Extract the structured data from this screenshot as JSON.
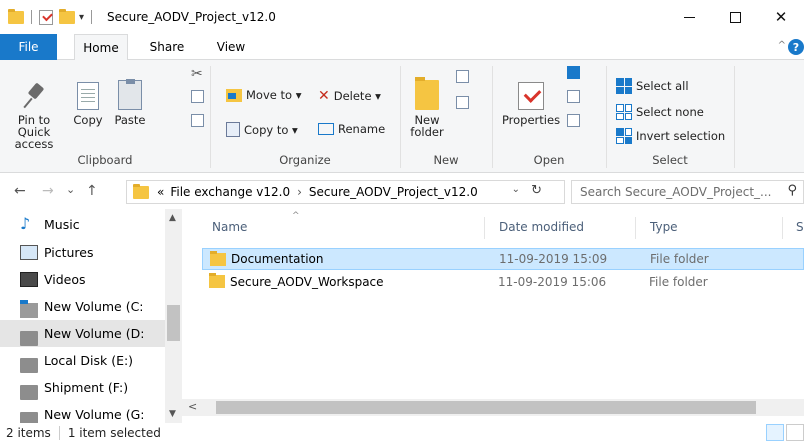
{
  "window": {
    "title": "Secure_AODV_Project_v12.0",
    "qa_arrow": "▾",
    "minimize": "—",
    "maximize": "☐",
    "close": "✕"
  },
  "ribbon_tabs": [
    {
      "label": "File",
      "active": false
    },
    {
      "label": "Home",
      "active": true
    },
    {
      "label": "Share",
      "active": false
    },
    {
      "label": "View",
      "active": false
    }
  ],
  "ribbon": {
    "clipboard": {
      "pin_label": "Pin to Quick access",
      "copy_label": "Copy",
      "paste_label": "Paste",
      "group": "Clipboard"
    },
    "organize": {
      "move_to": "Move to ▾",
      "copy_to": "Copy to ▾",
      "delete": "Delete ▾",
      "rename": "Rename",
      "group": "Organize"
    },
    "new": {
      "new_folder": "New folder",
      "group": "New"
    },
    "open": {
      "properties": "Properties",
      "group": "Open"
    },
    "select": {
      "select_all": "Select all",
      "select_none": "Select none",
      "invert": "Invert selection",
      "group": "Select"
    }
  },
  "address": {
    "back": "←",
    "forward": "→",
    "recent": "⌄",
    "up": "↑",
    "overflow": "«",
    "crumbs": [
      "File exchange v12.0",
      "Secure_AODV_Project_v12.0"
    ],
    "separator": "›",
    "search_placeholder": "Search Secure_AODV_Project_...",
    "refresh": "↻",
    "dropdown": "⌄"
  },
  "nav_pane": {
    "items": [
      {
        "label": "Music",
        "icon": "music-icon"
      },
      {
        "label": "Pictures",
        "icon": "pictures-icon"
      },
      {
        "label": "Videos",
        "icon": "videos-icon"
      },
      {
        "label": "New Volume (C:",
        "icon": "os-drive-icon"
      },
      {
        "label": "New Volume (D:",
        "icon": "drive-icon",
        "selected": true
      },
      {
        "label": "Local Disk (E:)",
        "icon": "drive-icon"
      },
      {
        "label": "Shipment (F:)",
        "icon": "drive-icon"
      },
      {
        "label": "New Volume (G:",
        "icon": "drive-icon"
      }
    ]
  },
  "file_list": {
    "columns": [
      "Name",
      "Date modified",
      "Type",
      "S"
    ],
    "rows": [
      {
        "name": "Documentation",
        "date": "11-09-2019 15:09",
        "type": "File folder",
        "selected": true
      },
      {
        "name": "Secure_AODV_Workspace",
        "date": "11-09-2019 15:06",
        "type": "File folder",
        "selected": false
      }
    ]
  },
  "status": {
    "items": "2 items",
    "selected": "1 item selected"
  },
  "colors": {
    "accent": "#1979ca",
    "selection": "#cce8ff",
    "folder": "#f5c542"
  }
}
